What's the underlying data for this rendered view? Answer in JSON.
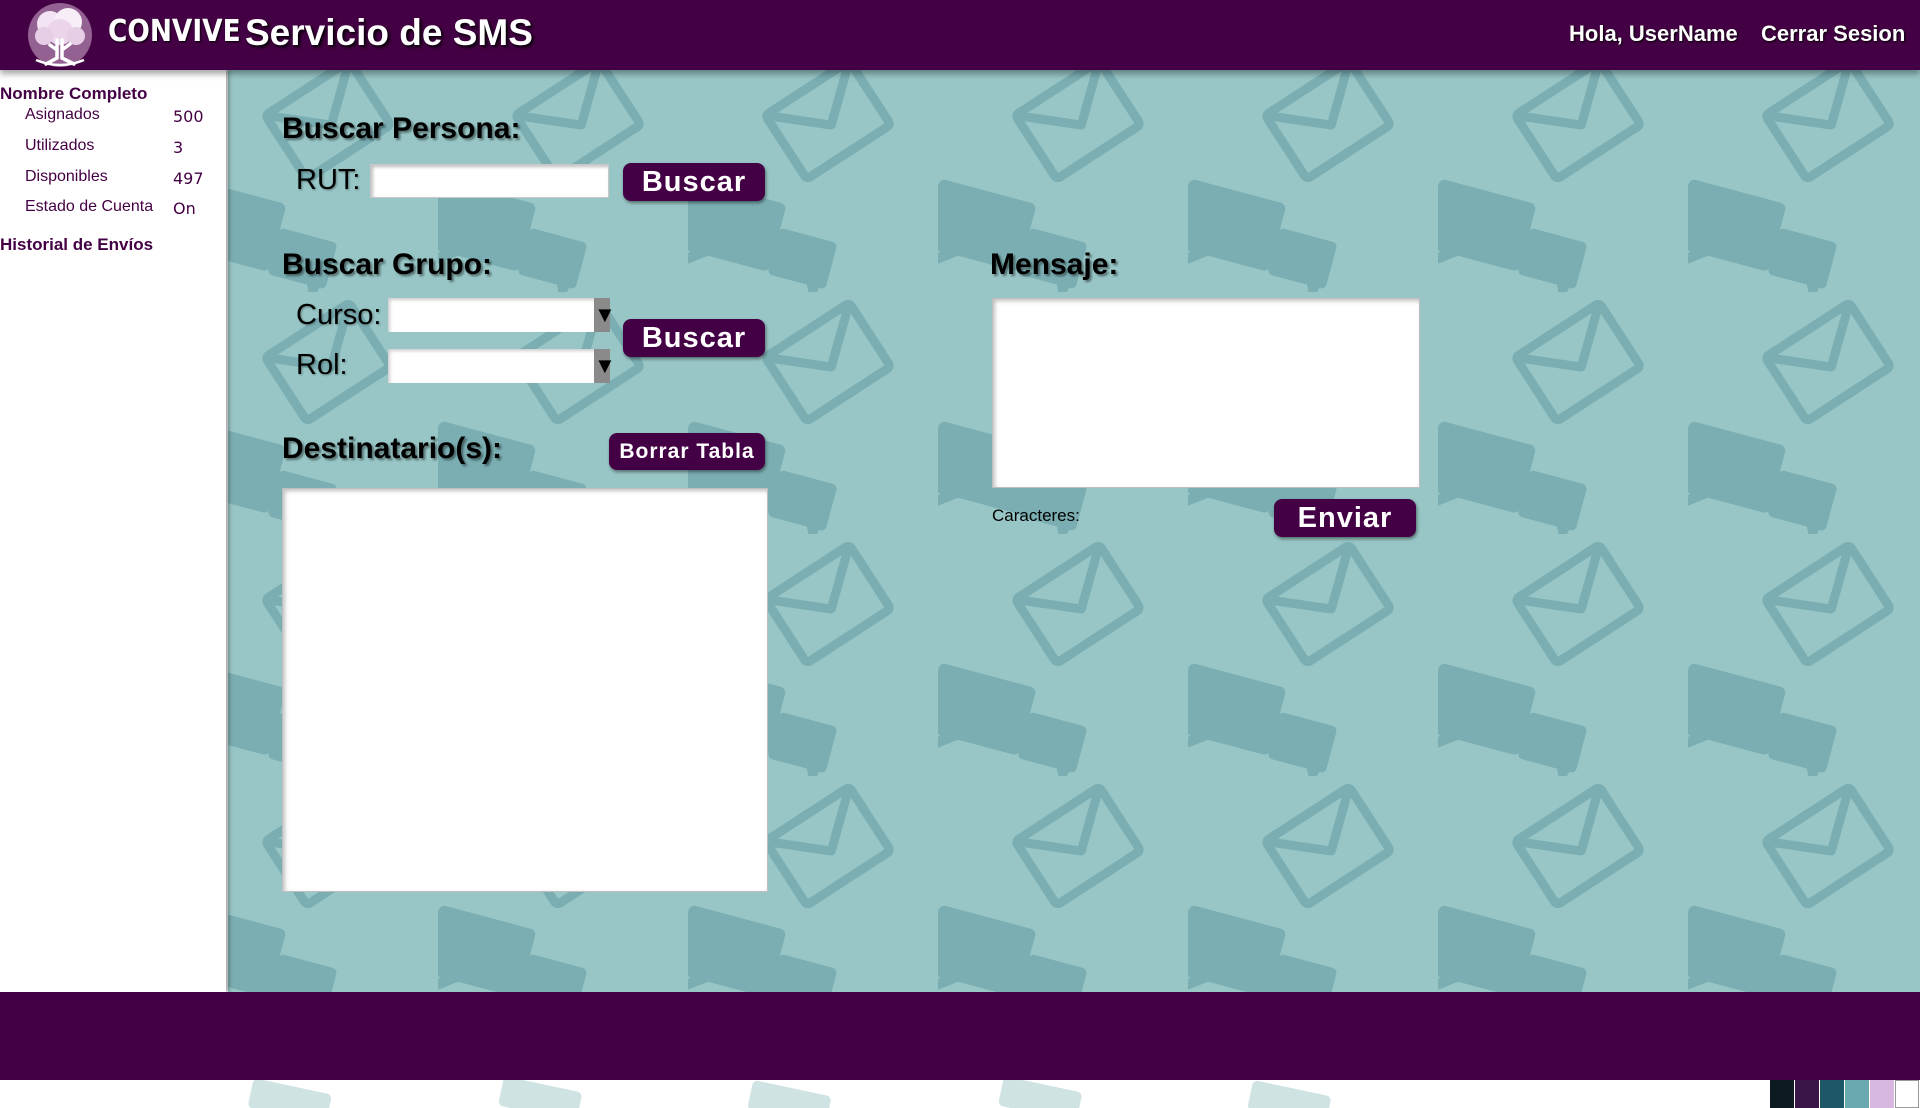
{
  "header": {
    "brand": "CONVIVE",
    "title": "Servicio de SMS",
    "greeting": "Hola, UserName",
    "logout_label": "Cerrar Sesion"
  },
  "sidebar": {
    "name": "Nombre Completo",
    "stats": [
      {
        "label": "Asignados",
        "value": "500"
      },
      {
        "label": "Utilizados",
        "value": "3"
      },
      {
        "label": "Disponibles",
        "value": "497"
      },
      {
        "label": "Estado de Cuenta",
        "value": "On"
      }
    ],
    "history_label": "Historial de Envíos"
  },
  "search_person": {
    "heading": "Buscar Persona:",
    "rut_label": "RUT:",
    "rut_value": "",
    "button_label": "Buscar"
  },
  "search_group": {
    "heading": "Buscar Grupo:",
    "curso_label": "Curso:",
    "curso_value": "",
    "rol_label": "Rol:",
    "rol_value": "",
    "button_label": "Buscar"
  },
  "recipients": {
    "heading": "Destinatario(s):",
    "clear_label": "Borrar Tabla"
  },
  "message": {
    "heading": "Mensaje:",
    "value": "",
    "chars_label": "Caracteres:",
    "send_label": "Enviar"
  },
  "colors": {
    "primary": "#440044",
    "background": "#98c6c6",
    "pattern": "#7aaeb2",
    "palette": [
      "#0e1a22",
      "#3a1648",
      "#1e5868",
      "#6aa8b0",
      "#d8b8e0",
      "#ffffff"
    ]
  }
}
